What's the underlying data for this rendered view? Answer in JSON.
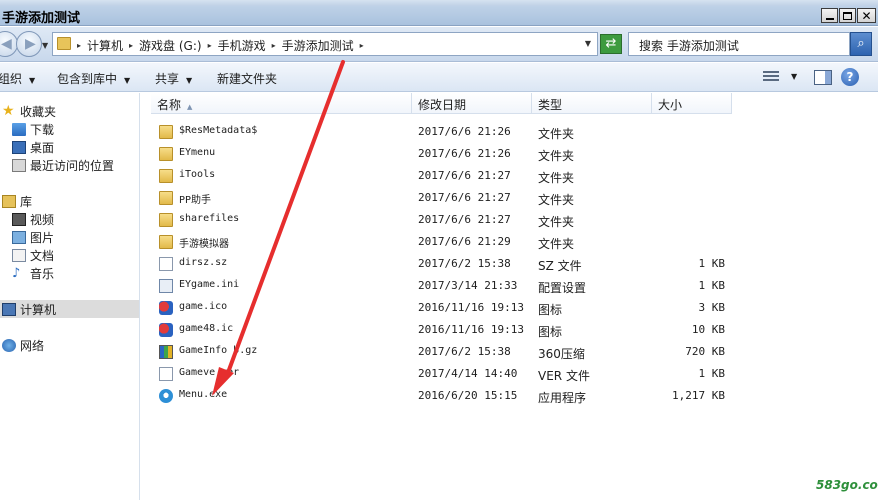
{
  "window": {
    "title": "手游添加测试"
  },
  "address": {
    "crumbs": [
      "计算机",
      "游戏盘 (G:)",
      "手机游戏",
      "手游添加测试"
    ]
  },
  "search": {
    "placeholder": "搜索 手游添加测试"
  },
  "toolbar": {
    "organize": "组织",
    "include_in_library": "包含到库中",
    "share": "共享",
    "new_folder": "新建文件夹"
  },
  "nav": {
    "favorites": "收藏夹",
    "downloads": "下载",
    "desktop": "桌面",
    "recent": "最近访问的位置",
    "libraries": "库",
    "videos": "视频",
    "pictures": "图片",
    "documents": "文档",
    "music": "音乐",
    "computer": "计算机",
    "network": "网络"
  },
  "columns": {
    "name": "名称",
    "date": "修改日期",
    "type": "类型",
    "size": "大小"
  },
  "files": [
    {
      "name": "$ResMetadata$",
      "date": "2017/6/6 21:26",
      "type": "文件夹",
      "size": "",
      "icon": "folder-icon"
    },
    {
      "name": "EYmenu",
      "date": "2017/6/6 21:26",
      "type": "文件夹",
      "size": "",
      "icon": "folder-icon"
    },
    {
      "name": "iTools",
      "date": "2017/6/6 21:27",
      "type": "文件夹",
      "size": "",
      "icon": "folder-icon"
    },
    {
      "name": "PP助手",
      "date": "2017/6/6 21:27",
      "type": "文件夹",
      "size": "",
      "icon": "folder-icon"
    },
    {
      "name": "sharefiles",
      "date": "2017/6/6 21:27",
      "type": "文件夹",
      "size": "",
      "icon": "folder-icon"
    },
    {
      "name": "手游模拟器",
      "date": "2017/6/6 21:29",
      "type": "文件夹",
      "size": "",
      "icon": "folder-icon"
    },
    {
      "name": "dirsz.sz",
      "date": "2017/6/2 15:38",
      "type": "SZ 文件",
      "size": "1 KB",
      "icon": "file-icon"
    },
    {
      "name": "EYgame.ini",
      "date": "2017/3/14 21:33",
      "type": "配置设置",
      "size": "1 KB",
      "icon": "settings-file-icon"
    },
    {
      "name": "game.ico",
      "date": "2016/11/16 19:13",
      "type": "图标",
      "size": "3 KB",
      "icon": "icon-file-icon"
    },
    {
      "name": "game48.ic",
      "date": "2016/11/16 19:13",
      "type": "图标",
      "size": "10 KB",
      "icon": "icon-file-icon"
    },
    {
      "name": "GameInfo b.gz",
      "date": "2017/6/2 15:38",
      "type": "360压缩",
      "size": "720 KB",
      "icon": "archive-icon"
    },
    {
      "name": "Gameve ver",
      "date": "2017/4/14 14:40",
      "type": "VER 文件",
      "size": "1 KB",
      "icon": "file-icon"
    },
    {
      "name": "Menu.exe",
      "date": "2016/6/20 15:15",
      "type": "应用程序",
      "size": "1,217 KB",
      "icon": "application-icon"
    }
  ],
  "watermark": "583go.com",
  "accent_color": "#e62e2e"
}
